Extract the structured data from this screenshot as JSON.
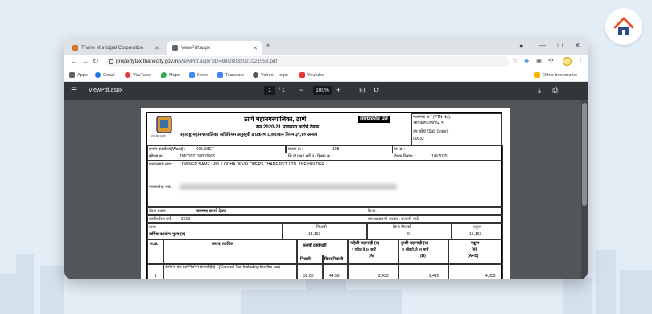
{
  "browser": {
    "tabs": [
      {
        "title": "Thane Municipal Corporation"
      },
      {
        "title": "ViewPdf.aspx"
      }
    ],
    "url_host": "propertytax.thanecity.gov.in",
    "url_path": "/ViewPdf.aspx?ID=Bill28032021021553.pdf",
    "bookmarks": [
      "Apps",
      "Gmail",
      "YouTube",
      "Maps",
      "News",
      "Translate",
      "Yahoo – login",
      "Youtube"
    ],
    "other_bookmarks": "Other bookmarks"
  },
  "pdf_toolbar": {
    "title": "ViewPdf.aspx",
    "page": "1",
    "total": "/ 1",
    "zoom": "100%"
  },
  "document": {
    "corp_name": "ठाणे महानगरपालिका, ठाणे",
    "bill_title": "सन 2020-21 मालमत्ता करांचे देयक",
    "stamp": "संगणकीय प्रत",
    "subtitle": "महाराष्ट्र महानगरपालिका अधिनियम अनुसूची ड प्रकरण ८,कराधान नियम ३९,४० अन्वये",
    "logo_caption": "सत्य मेव जयते",
    "ptn_label": "मालमत्ता क्र / (PTN No):",
    "ptn_value": "181905108004 3",
    "subcode_label": "उप कोड/ (Sub Code):",
    "subcode_value": "00032",
    "ward_label": "प्रभाग कार्यालय(Ward) :",
    "ward_value": "KOLSHET",
    "prabhag_label": "प्रभाग क्र :",
    "prabhag_value": "108",
    "ghar_label": "घर क्र :",
    "index_label": "इंडेक्स क्र :",
    "index_value": "TMC202110802668",
    "survey_label": "सि.टी.एस / सर्वे नं / हिस्सा क्र :",
    "date_label": "देयक दिनांक :",
    "date_value": "1/4/2020",
    "owner_label": "करदात्याचे नाव :",
    "owner_value": "/ OWNER NAME :M/S. LODHA DEVELOPERS THANE PVT. LTD. THE HOLDER :",
    "address_label": "मालमत्तेचा पत्ता :",
    "bill_type_label": "देयक प्रकार :",
    "bill_type_value": "मालमत्ता कराचे देयक",
    "bill_no_label": "बि.क्र. :",
    "assess_year_label": "करनिर्धारण वर्ष :",
    "assess_year_value": "2018",
    "usage_label": "कर आकारणी आधार : बाजारी भाडे",
    "type_label": "वापर",
    "residential": "निवासी",
    "nonresidential": "बिगर निवासी",
    "total": "एकूण",
    "annual_label": "वार्षिक करयोग्य मूल्य (रु)",
    "annual_res": "15,163",
    "annual_nonres": "0",
    "annual_total": "15,163",
    "sr_head": "अ.क्र.",
    "tax_head": "कराचा तपशिल",
    "rate_head": "कराची टक्केवारी",
    "rate_res": "निवासी",
    "rate_nonres": "बिगर निवासी",
    "first_inst": "पहिली सहामाही (रु)",
    "first_inst_period": "१ एप्रिल ते ३० सप्टें",
    "first_letter": "(A)",
    "second_inst": "दुसरी सहामाही (रु)",
    "second_inst_period": "१ ऑक्टो. ते ३१ मार्च",
    "second_letter": "(B)",
    "sum_head": "एकूण",
    "sum_sub": "(रु)",
    "sum_letter": "(A+B)",
    "row1_no": "1",
    "row1_tax": "सामान्य कर (अग्निशमन करासहित) / (General Tax Including the fire tax)",
    "row1_rate_res": "32.00",
    "row1_rate_nonres": "44.50",
    "row1_a": "2,433",
    "row1_b": "2,420",
    "row1_total": "4,853"
  }
}
